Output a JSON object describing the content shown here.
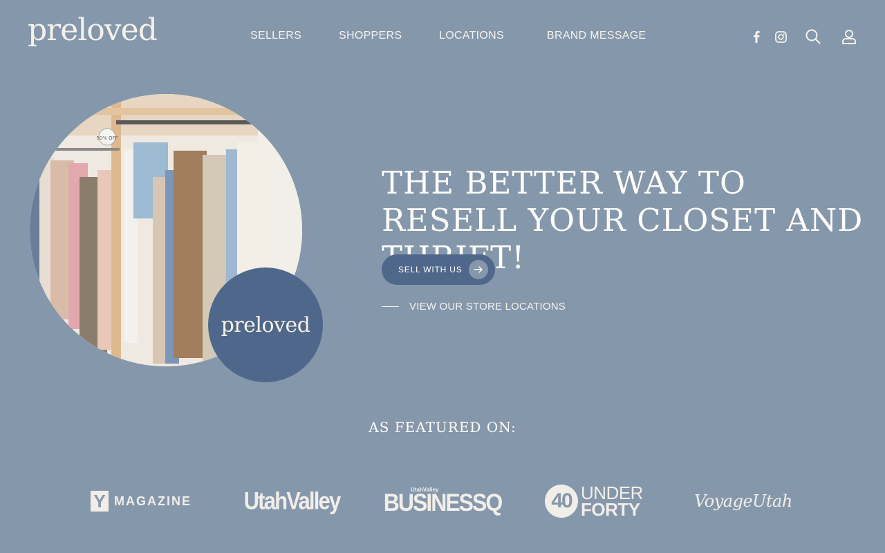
{
  "brand": {
    "logo": "preloved",
    "badge_logo": "preloved"
  },
  "nav": {
    "items": [
      {
        "label": "SELLERS"
      },
      {
        "label": "SHOPPERS"
      },
      {
        "label": "LOCATIONS"
      },
      {
        "label": "BRAND MESSAGE"
      }
    ]
  },
  "header_icons": [
    "facebook-icon",
    "instagram-icon",
    "search-icon",
    "account-icon"
  ],
  "hero": {
    "image_sign": "50% OFF",
    "headline": "THE BETTER WAY TO RESELL YOUR CLOSET AND THRIFT!",
    "cta_label": "SELL WITH US",
    "link_label": "VIEW OUR STORE LOCATIONS"
  },
  "featured": {
    "title": "AS FEATURED ON:",
    "logos": {
      "ymag_letter": "Y",
      "ymag_word": "MAGAZINE",
      "utah_valley": "UtahValley",
      "bq_small": "UtahValley",
      "bq_word": "BUSINESSQ",
      "forty_num": "40",
      "forty_under": "UNDER",
      "forty_forty": "FORTY",
      "voyage": "VoyageUtah"
    }
  },
  "colors": {
    "background": "#8597aa",
    "accent": "#4f678a",
    "text": "#ffffff"
  }
}
